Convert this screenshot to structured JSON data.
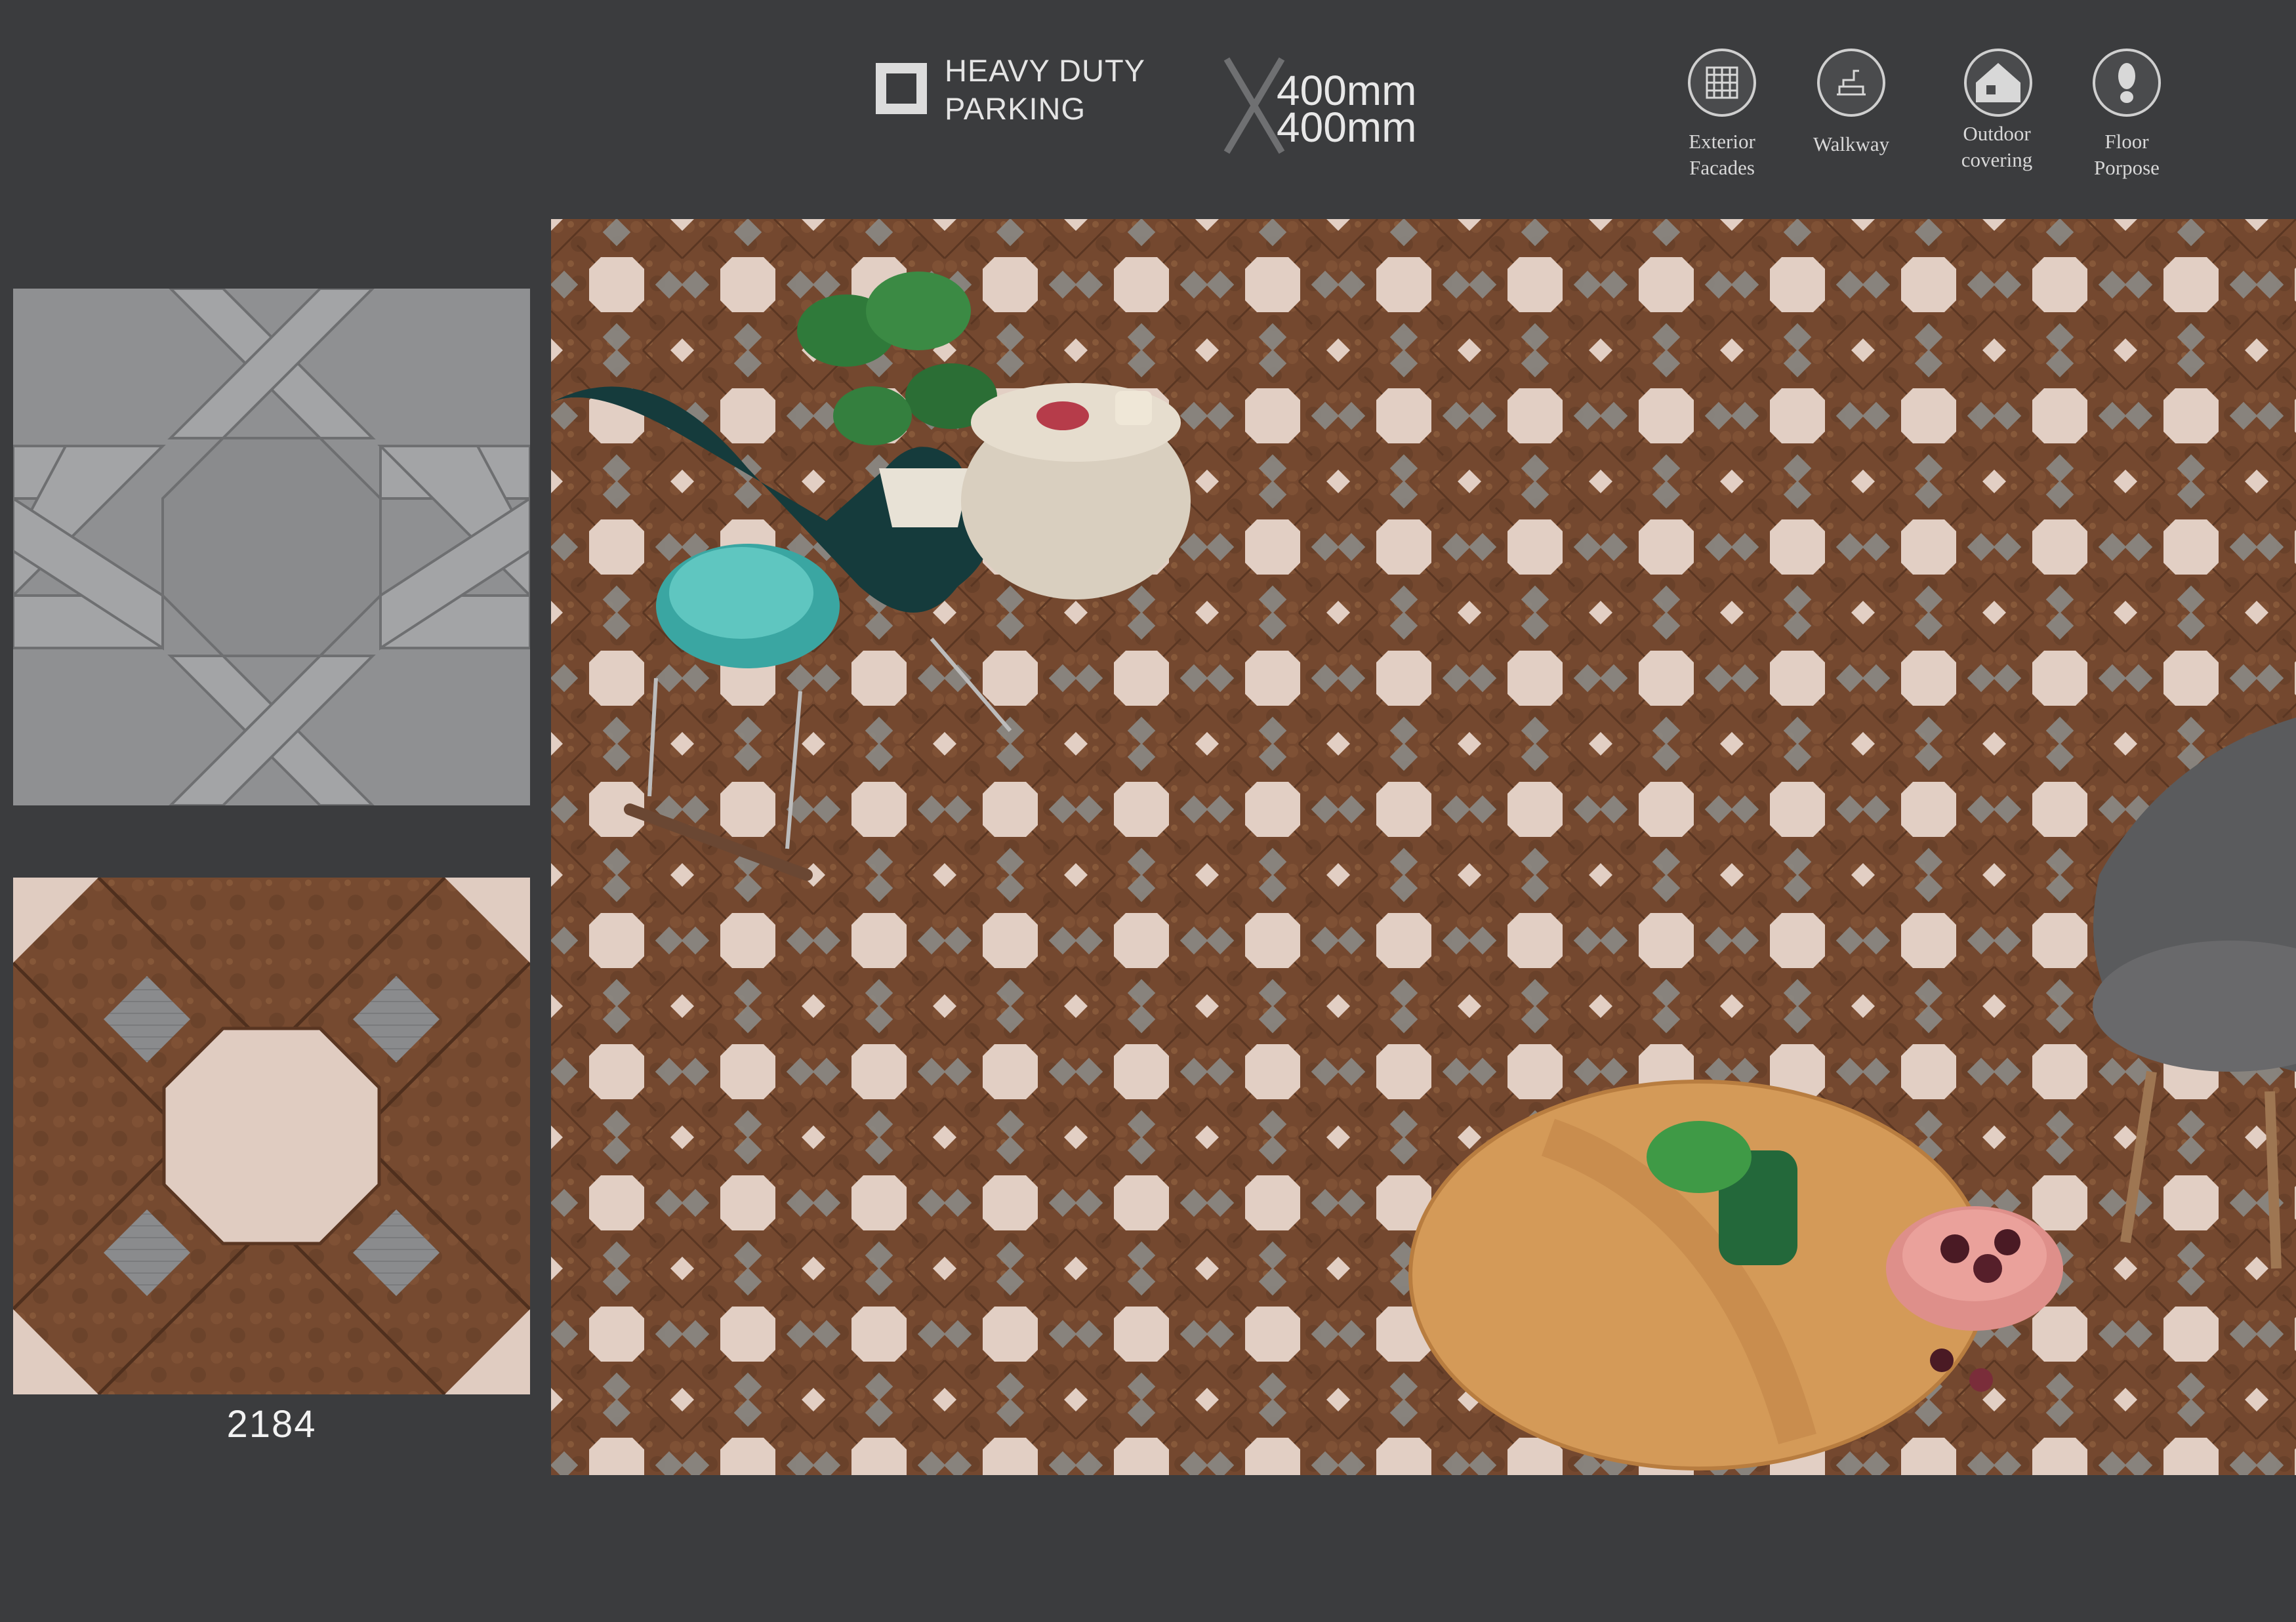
{
  "header": {
    "feature_line1": "HEAVY DUTY",
    "feature_line2": "PARKING",
    "size_width": "400mm",
    "size_height": "400mm"
  },
  "applications": [
    {
      "icon": "exterior-facades-icon",
      "label_line1": "Exterior",
      "label_line2": "Facades"
    },
    {
      "icon": "walkway-icon",
      "label_line1": "Walkway",
      "label_line2": ""
    },
    {
      "icon": "outdoor-covering-icon",
      "label_line1": "Outdoor",
      "label_line2": "covering"
    },
    {
      "icon": "floor-purpose-icon",
      "label_line1": "Floor",
      "label_line2": "Porpose"
    }
  ],
  "tile": {
    "code": "2184"
  },
  "colors": {
    "background": "#3b3c3e",
    "tile_brown": "#7a4e32",
    "tile_cream": "#e3cfc3",
    "tile_grey": "#8c8d8f"
  }
}
